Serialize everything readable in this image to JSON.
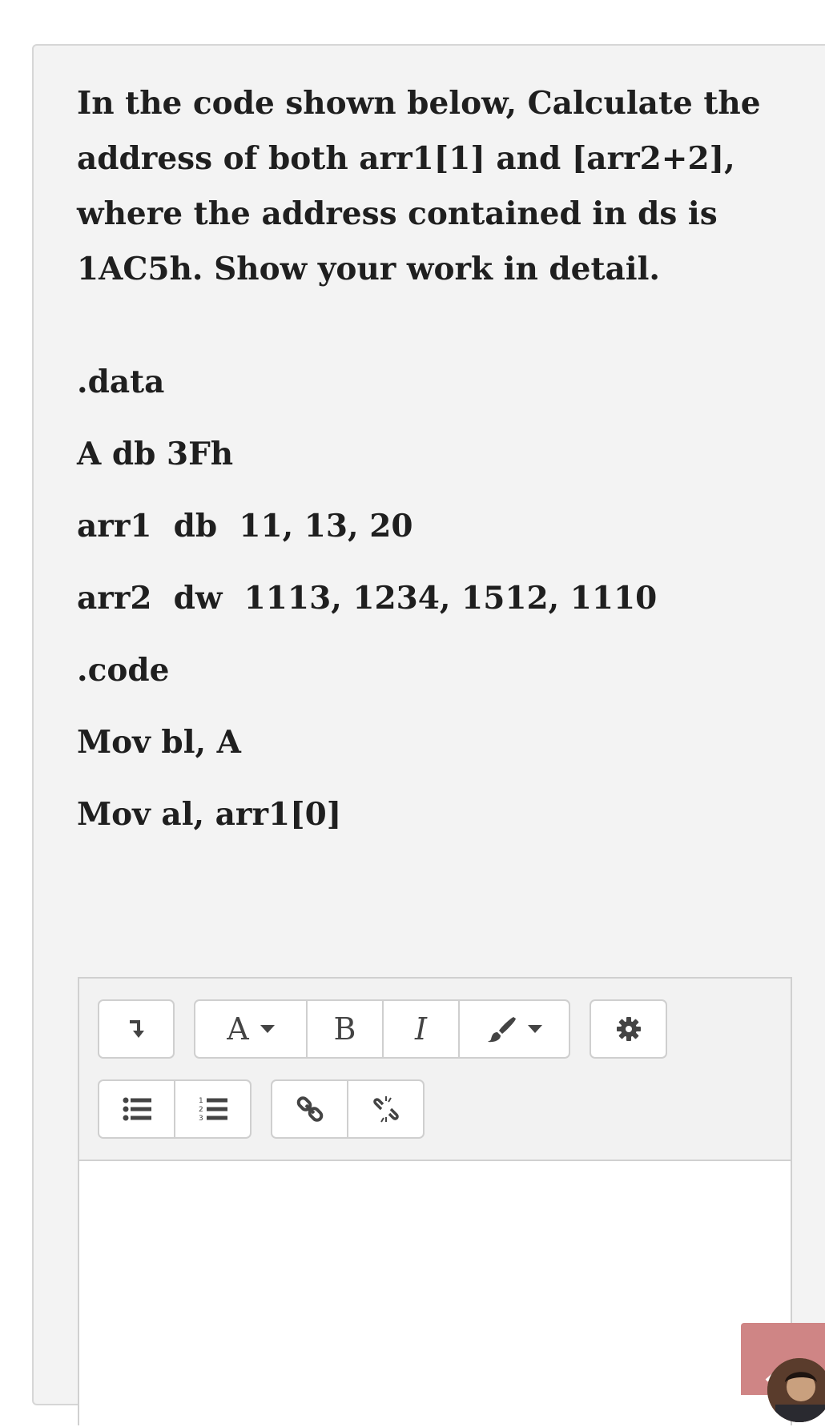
{
  "question": {
    "prompt": "In the code shown below, Calculate the address of both arr1[1] and [arr2+2], where the address contained in  ds  is 1AC5h.  Show your work in detail.",
    "code_lines": [
      ".data",
      "A db 3Fh",
      "arr1  db  11, 13, 20",
      "arr2  dw  1113, 1234, 1512, 1110",
      ".code",
      "Mov bl, A",
      "Mov al, arr1[0]"
    ]
  },
  "editor": {
    "toolbar": {
      "font_label": "A",
      "bold_label": "B",
      "italic_label": "I"
    },
    "icons": [
      "collapse-arrow-icon",
      "font-color-icon",
      "bold-icon",
      "italic-icon",
      "paintbrush-icon",
      "gear-icon",
      "unordered-list-icon",
      "ordered-list-icon",
      "link-icon",
      "unlink-icon"
    ],
    "content": ""
  },
  "colors": {
    "card_background": "#f3f3f3",
    "text": "#1f1f1f",
    "toolbar_icon": "#444444",
    "scroll_button": "#cf8585"
  }
}
